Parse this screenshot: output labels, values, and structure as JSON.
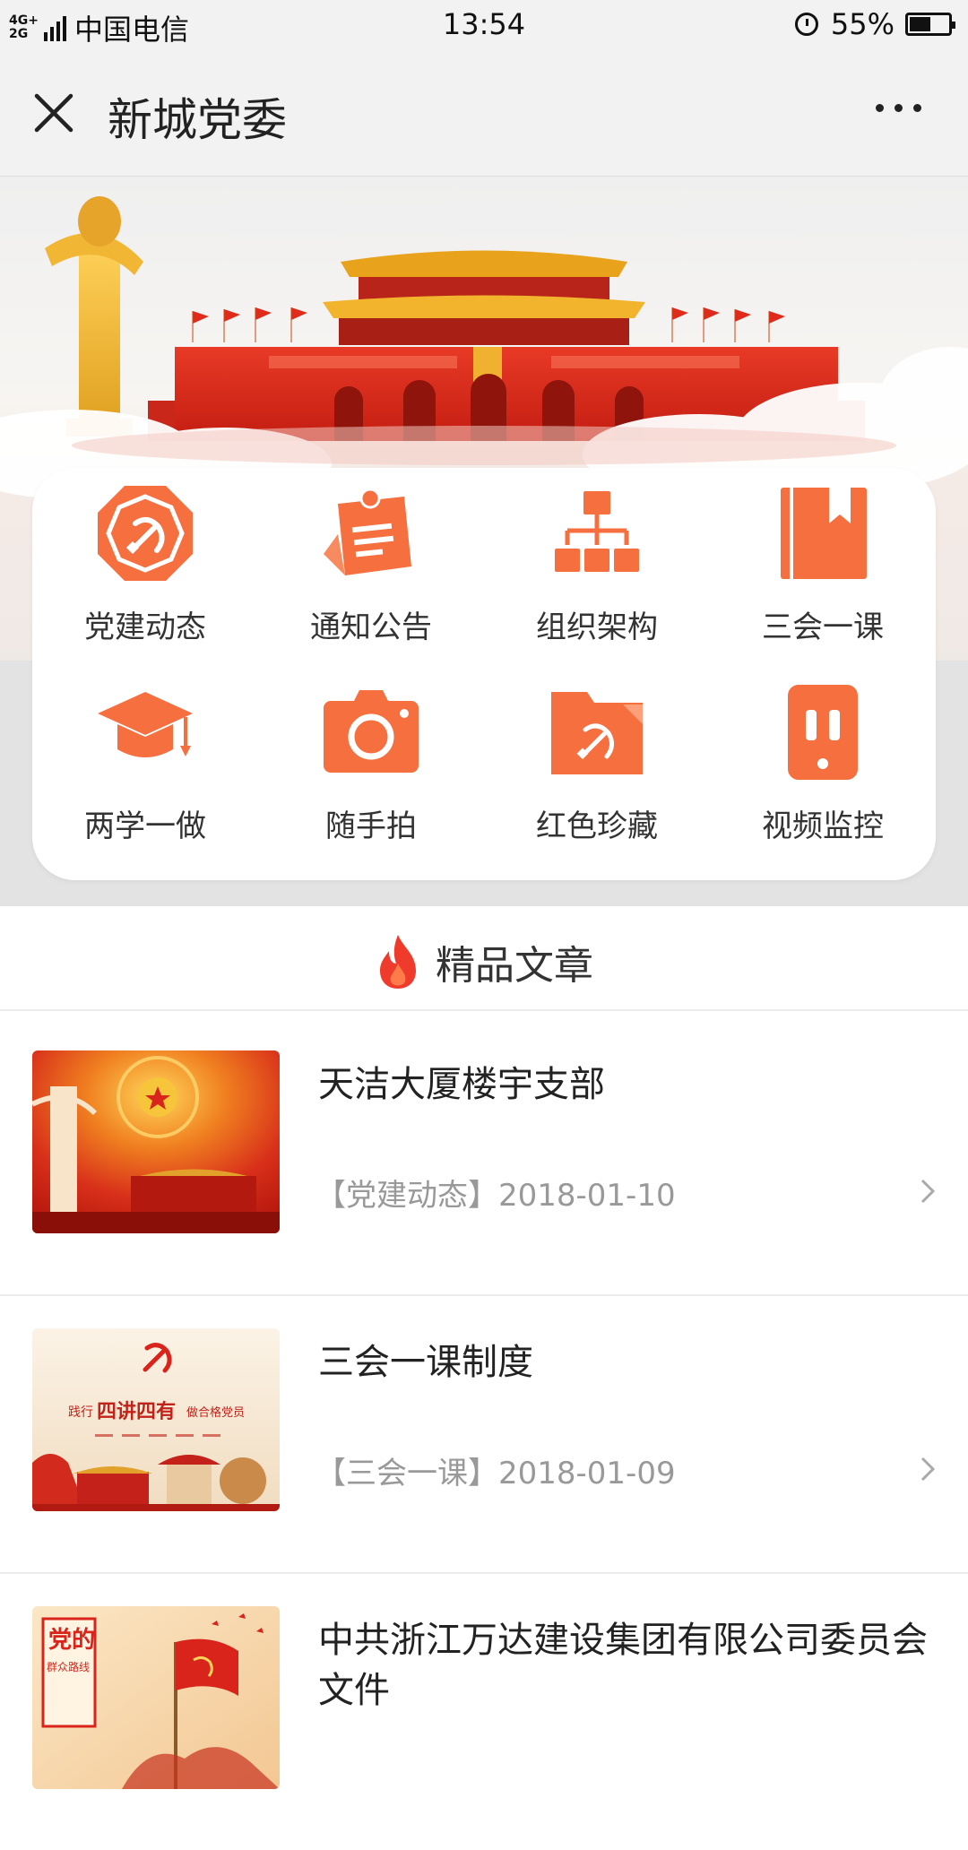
{
  "status_bar": {
    "network_top": "4G+",
    "network_bottom": "2G",
    "carrier": "中国电信",
    "time": "13:54",
    "battery_percent_label": "55%",
    "battery_level": 0.55
  },
  "nav": {
    "title": "新城党委"
  },
  "menu": [
    {
      "label": "党建动态",
      "icon": "party-emblem-octagon-icon"
    },
    {
      "label": "通知公告",
      "icon": "pinned-notice-icon"
    },
    {
      "label": "组织架构",
      "icon": "org-chart-icon"
    },
    {
      "label": "三会一课",
      "icon": "bookmark-book-icon"
    },
    {
      "label": "两学一做",
      "icon": "graduation-cap-icon"
    },
    {
      "label": "随手拍",
      "icon": "camera-icon"
    },
    {
      "label": "红色珍藏",
      "icon": "party-folder-icon"
    },
    {
      "label": "视频监控",
      "icon": "monitor-device-icon"
    }
  ],
  "section": {
    "title": "精品文章"
  },
  "articles": [
    {
      "title": "天洁大厦楼宇支部",
      "meta": "【党建动态】2018-01-10"
    },
    {
      "title": "三会一课制度",
      "meta": "【三会一课】2018-01-09"
    },
    {
      "title": "中共浙江万达建设集团有限公司委员会文件",
      "meta": ""
    }
  ],
  "thumb_text": {
    "article2_slogan_left": "践行",
    "article2_slogan_main": "四讲四有",
    "article2_slogan_right": "做合格党员",
    "article3_slogan_line1": "党的",
    "article3_slogan_line2": "群众路线"
  },
  "colors": {
    "accent_orange": "#f26a3d",
    "accent_orange_light": "#ff8a5c",
    "party_red": "#d9261c",
    "background_gray": "#f2f2f2"
  }
}
